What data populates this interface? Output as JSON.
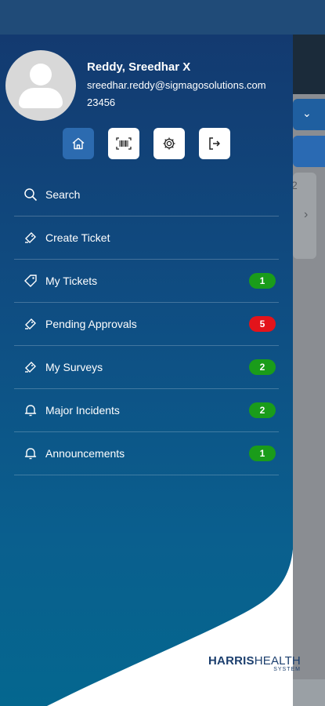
{
  "user": {
    "name": "Reddy, Sreedhar X",
    "email": "sreedhar.reddy@sigmagosolutions.com",
    "id": "23456"
  },
  "quick_actions": [
    {
      "icon": "home-icon",
      "active": true
    },
    {
      "icon": "barcode-icon",
      "active": false
    },
    {
      "icon": "settings-icon",
      "active": false
    },
    {
      "icon": "logout-icon",
      "active": false
    }
  ],
  "menu": [
    {
      "label": "Search",
      "icon": "search-icon"
    },
    {
      "label": "Create Ticket",
      "icon": "ticket-icon"
    },
    {
      "label": "My Tickets",
      "icon": "tag-icon",
      "badge": "1",
      "badge_color": "#1a9c1a"
    },
    {
      "label": "Pending Approvals",
      "icon": "ticket-icon",
      "badge": "5",
      "badge_color": "#e3141b"
    },
    {
      "label": "My Surveys",
      "icon": "ticket-icon",
      "badge": "2",
      "badge_color": "#1a9c1a"
    },
    {
      "label": "Major Incidents",
      "icon": "bell-icon",
      "badge": "2",
      "badge_color": "#1a9c1a"
    },
    {
      "label": "Announcements",
      "icon": "bell-icon",
      "badge": "1",
      "badge_color": "#1a9c1a"
    }
  ],
  "background": {
    "card_number": "2"
  },
  "logo": {
    "brand_bold": "HARRIS",
    "brand_light": "HEALTH",
    "sub": "SYSTEM"
  }
}
